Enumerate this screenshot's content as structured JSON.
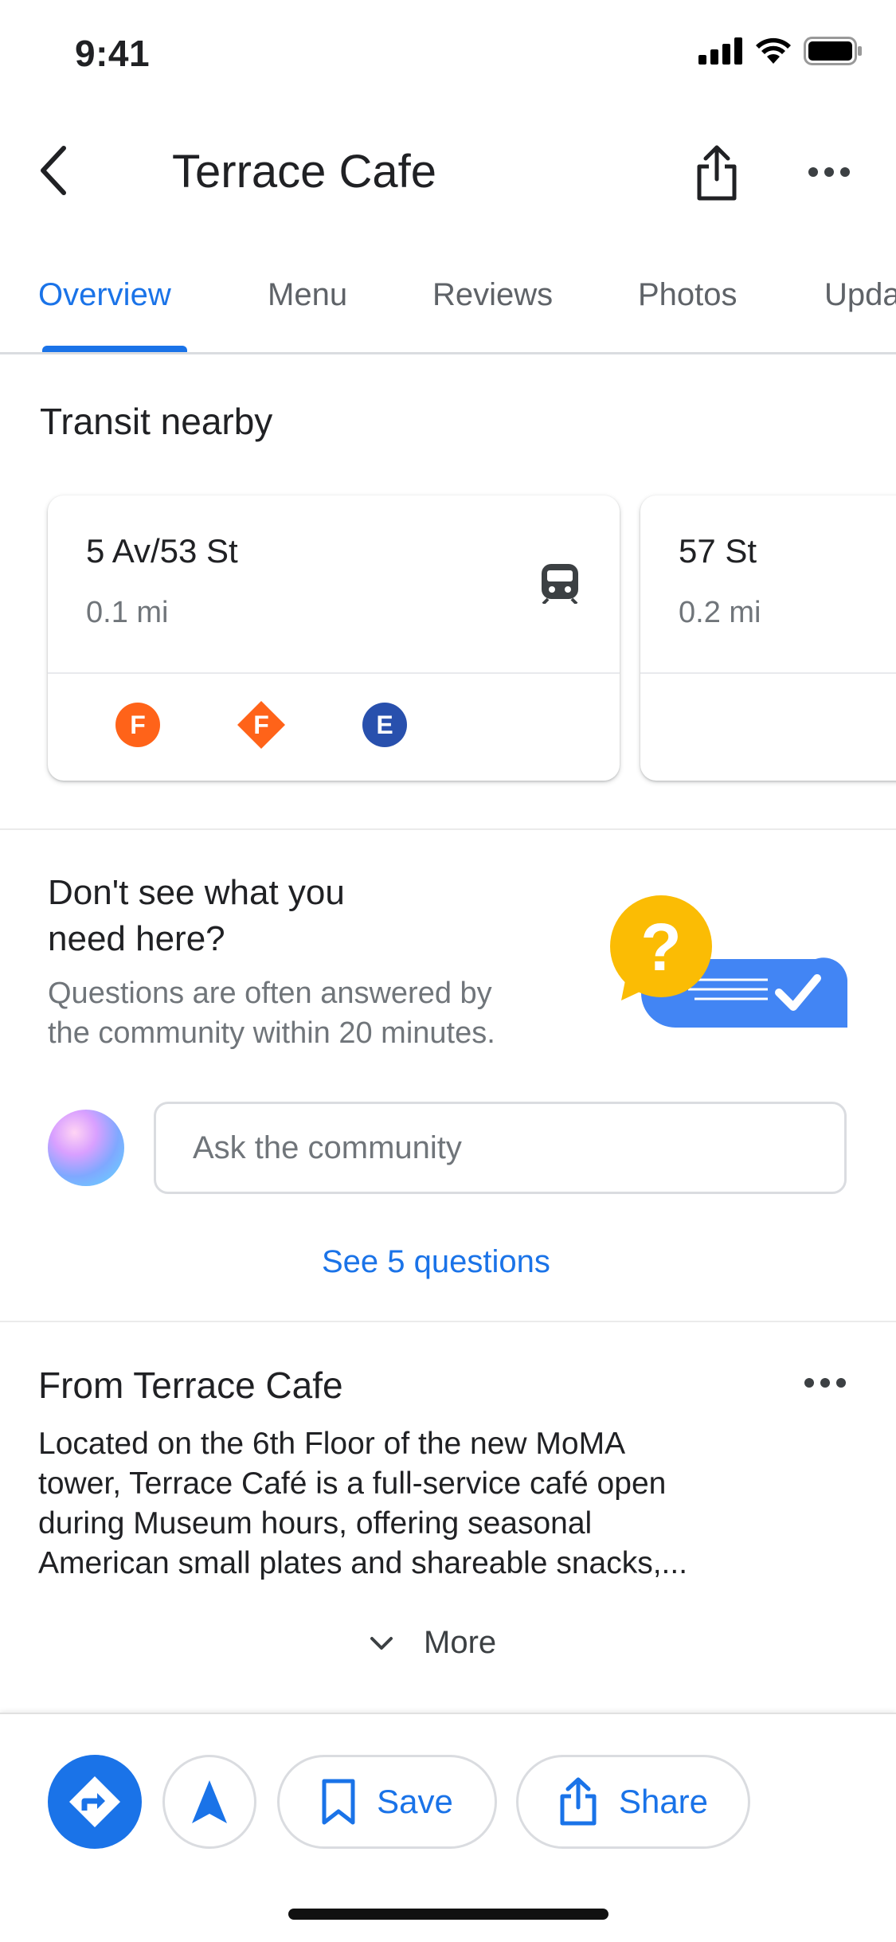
{
  "status_bar": {
    "time": "9:41"
  },
  "header": {
    "title": "Terrace Cafe"
  },
  "tabs": [
    {
      "label": "Overview"
    },
    {
      "label": "Menu"
    },
    {
      "label": "Reviews"
    },
    {
      "label": "Photos"
    },
    {
      "label": "Upda"
    }
  ],
  "transit": {
    "title": "Transit nearby",
    "stations": [
      {
        "name": "5 Av/53 St",
        "distance": "0.1 mi",
        "lines": [
          "F",
          "F",
          "E"
        ]
      },
      {
        "name": "57 St",
        "distance": "0.2 mi"
      }
    ]
  },
  "qa": {
    "title_line1": "Don't see what you",
    "title_line2": "need here?",
    "desc_line1": "Questions are often answered by",
    "desc_line2": "the community within 20 minutes.",
    "input_placeholder": "Ask the community",
    "see_questions": "See 5 questions",
    "question_mark": "?"
  },
  "from_section": {
    "title": "From Terrace Cafe",
    "description_line1": "Located on the 6th Floor of the new MoMA",
    "description_line2": "tower, Terrace Café is a full-service café open",
    "description_line3": "during Museum hours, offering seasonal",
    "description_line4": "American small plates and shareable snacks,...",
    "more_label": "More"
  },
  "bottom_bar": {
    "save_label": "Save",
    "share_label": "Share"
  },
  "colors": {
    "accent": "#1a73e8",
    "line_f": "#ff6319",
    "line_e": "#2850ad",
    "qa_yellow": "#fbbc04",
    "qa_blue": "#4285f4"
  }
}
